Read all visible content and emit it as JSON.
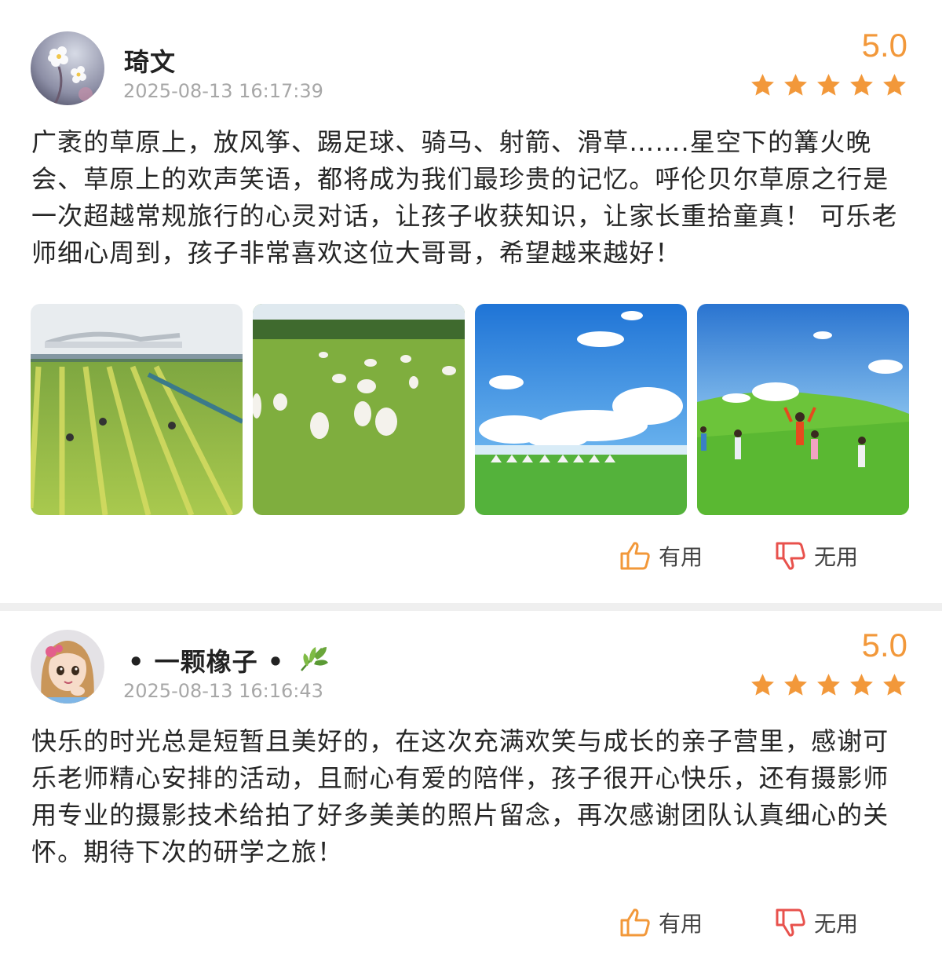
{
  "colors": {
    "accent": "#f2983a",
    "thumb_up": "#f2983a",
    "thumb_down": "#e8514c"
  },
  "reviews": [
    {
      "user": "琦文",
      "time": "2025-08-13 16:17:39",
      "score": "5.0",
      "stars": 5,
      "text": "广袤的草原上，放风筝、踢足球、骑马、射箭、滑草…….星空下的篝火晚会、草原上的欢声笑语，都将成为我们最珍贵的记忆。呼伦贝尔草原之行是一次超越常规旅行的心灵对话，让孩子收获知识，让家长重拾童真！ 可乐老师细心周到，孩子非常喜欢这位大哥哥，希望越来越好！",
      "helpful_label": "有用",
      "unhelpful_label": "无用"
    },
    {
      "user": "• 一颗橡子 •",
      "user_icon": "leaf-icon",
      "time": "2025-08-13 16:16:43",
      "score": "5.0",
      "stars": 5,
      "text": "快乐的时光总是短暂且美好的，在这次充满欢笑与成长的亲子营里，感谢可乐老师精心安排的活动，且耐心有爱的陪伴，孩子很开心快乐，还有摄影师用专业的摄影技术给拍了好多美美的照片留念，再次感谢团队认真细心的关怀。期待下次的研学之旅！",
      "helpful_label": "有用",
      "unhelpful_label": "无用"
    }
  ]
}
